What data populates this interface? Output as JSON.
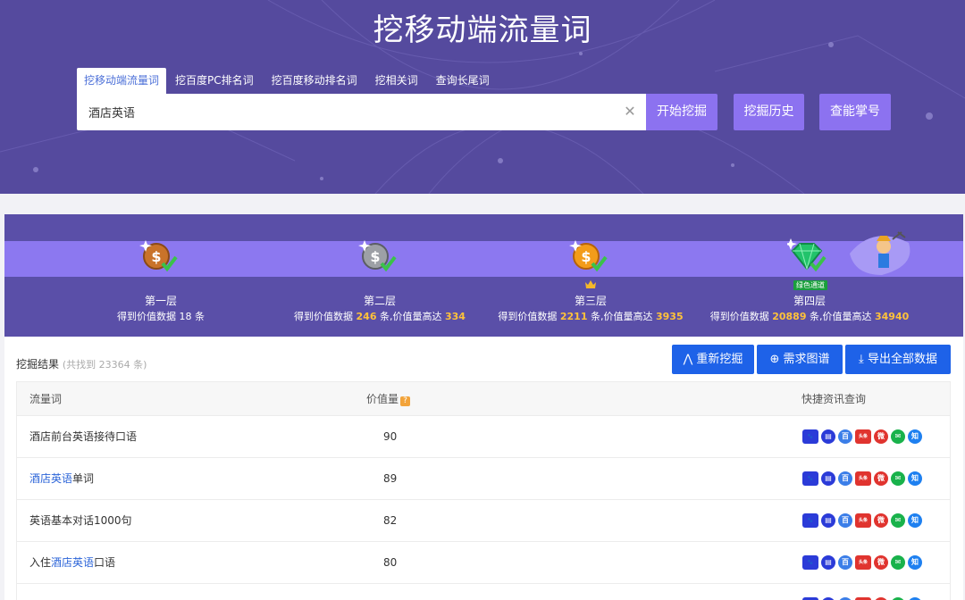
{
  "header": {
    "title": "挖移动端流量词",
    "tabs": [
      "挖移动端流量词",
      "挖百度PC排名词",
      "挖百度移动排名词",
      "挖相关词",
      "查询长尾词"
    ],
    "search_value": "酒店英语",
    "buttons": {
      "start": "开始挖掘",
      "history": "挖掘历史",
      "power": "查能掌号"
    }
  },
  "levels": [
    {
      "name": "第一层",
      "desc_pre": "得到价值数据 18 条",
      "count": "",
      "desc_mid": "",
      "max": "",
      "coin": "bronze",
      "badge": ""
    },
    {
      "name": "第二层",
      "desc_pre": "得到价值数据 ",
      "count": "246",
      "desc_mid": " 条,价值量高达 ",
      "max": "334",
      "coin": "silver",
      "badge": ""
    },
    {
      "name": "第三层",
      "desc_pre": "得到价值数据 ",
      "count": "2211",
      "desc_mid": " 条,价值量高达 ",
      "max": "3935",
      "coin": "gold",
      "badge": "crown"
    },
    {
      "name": "第四层",
      "desc_pre": "得到价值数据 ",
      "count": "20889",
      "desc_mid": " 条,价值量高达 ",
      "max": "34940",
      "coin": "emerald",
      "badge": "绿色通道"
    }
  ],
  "results": {
    "title": "挖掘结果",
    "found": "(共找到 23364 条)",
    "buttons": {
      "redig": "重新挖掘",
      "graph": "需求图谱",
      "export": "导出全部数据"
    },
    "columns": {
      "keyword": "流量词",
      "value": "价值量",
      "quick": "快捷资讯查询"
    },
    "rows": [
      {
        "pre": "酒店前台英语接待口语",
        "hl": "",
        "post": "",
        "value": "90"
      },
      {
        "pre": "",
        "hl": "酒店英语",
        "post": "单词",
        "value": "89"
      },
      {
        "pre": "英语基本对话1000句",
        "hl": "",
        "post": "",
        "value": "82"
      },
      {
        "pre": "入住",
        "hl": "酒店英语",
        "post": "口语",
        "value": "80"
      }
    ],
    "quick_icons": [
      {
        "name": "baidu-paw-icon",
        "glyph": "🐾",
        "color": "#2b3bd8"
      },
      {
        "name": "baidu-doc-icon",
        "glyph": "▤",
        "color": "#2b3bd8"
      },
      {
        "name": "baike-icon",
        "glyph": "百",
        "color": "#3b7ee8"
      },
      {
        "name": "toutiao-icon",
        "glyph": "头条",
        "color": "#e0342f"
      },
      {
        "name": "weibo-icon",
        "glyph": "微",
        "color": "#e0342f"
      },
      {
        "name": "wechat-icon",
        "glyph": "✉",
        "color": "#19b24b"
      },
      {
        "name": "zhihu-icon",
        "glyph": "知",
        "color": "#1e80f0"
      }
    ]
  }
}
